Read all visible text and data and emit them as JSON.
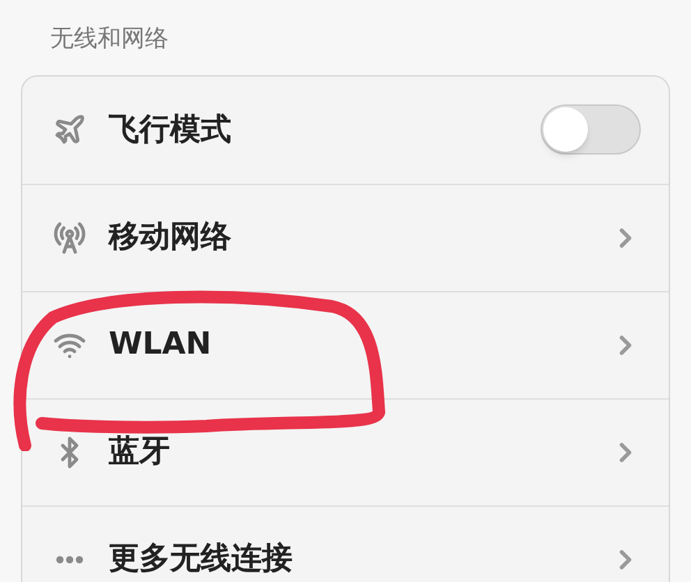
{
  "section_title": "无线和网络",
  "items": [
    {
      "kind": "toggle",
      "label": "飞行模式",
      "on": false
    },
    {
      "kind": "link",
      "label": "移动网络"
    },
    {
      "kind": "link",
      "label": "WLAN"
    },
    {
      "kind": "link",
      "label": "蓝牙"
    },
    {
      "kind": "link",
      "label": "更多无线连接"
    }
  ]
}
